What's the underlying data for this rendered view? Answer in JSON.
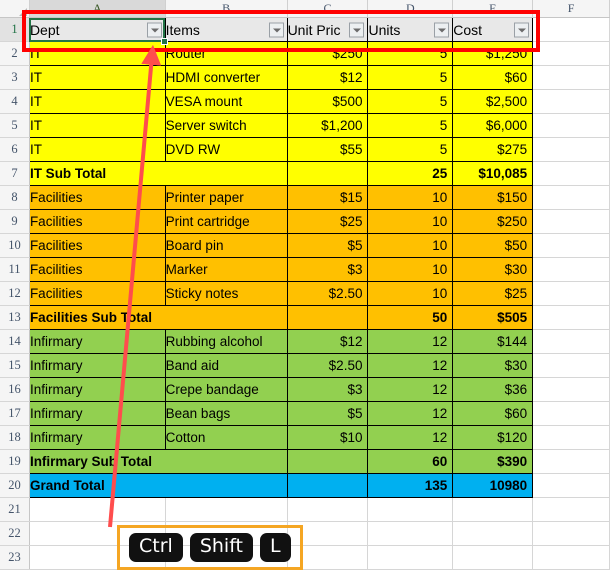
{
  "app": {
    "type": "spreadsheet",
    "column_letters": [
      "A",
      "B",
      "C",
      "D",
      "E",
      "F"
    ],
    "active_cell": "A1",
    "active_column": "A",
    "active_row": "1"
  },
  "colors": {
    "it_fill": "#FFFF00",
    "facilities_fill": "#FFC000",
    "infirmary_fill": "#92D050",
    "grand_total_fill": "#00B0F0",
    "header_fill": "#E8E8E8",
    "callout_red": "#FF0000",
    "callout_orange": "#F5A623",
    "selection_green": "#217346"
  },
  "table": {
    "headers": [
      "Dept",
      "Items",
      "Unit Pric",
      "Units",
      "Cost"
    ],
    "header_full": [
      "Dept",
      "Items",
      "Unit Price",
      "Units",
      "Cost"
    ],
    "rows": [
      {
        "num": "2",
        "section": "it",
        "cells": [
          "IT",
          "Router",
          "$250",
          "5",
          "$1,250"
        ],
        "bold": false
      },
      {
        "num": "3",
        "section": "it",
        "cells": [
          "IT",
          "HDMI converter",
          "$12",
          "5",
          "$60"
        ],
        "bold": false
      },
      {
        "num": "4",
        "section": "it",
        "cells": [
          "IT",
          "VESA mount",
          "$500",
          "5",
          "$2,500"
        ],
        "bold": false
      },
      {
        "num": "5",
        "section": "it",
        "cells": [
          "IT",
          "Server switch",
          "$1,200",
          "5",
          "$6,000"
        ],
        "bold": false
      },
      {
        "num": "6",
        "section": "it",
        "cells": [
          "IT",
          "DVD RW",
          "$55",
          "5",
          "$275"
        ],
        "bold": false
      },
      {
        "num": "7",
        "section": "it",
        "cells": [
          "IT Sub Total",
          "",
          "",
          "25",
          "$10,085"
        ],
        "bold": true,
        "span_ab": true
      },
      {
        "num": "8",
        "section": "facilities",
        "cells": [
          "Facilities",
          "Printer paper",
          "$15",
          "10",
          "$150"
        ],
        "bold": false
      },
      {
        "num": "9",
        "section": "facilities",
        "cells": [
          "Facilities",
          "Print cartridge",
          "$25",
          "10",
          "$250"
        ],
        "bold": false
      },
      {
        "num": "10",
        "section": "facilities",
        "cells": [
          "Facilities",
          "Board pin",
          "$5",
          "10",
          "$50"
        ],
        "bold": false
      },
      {
        "num": "11",
        "section": "facilities",
        "cells": [
          "Facilities",
          "Marker",
          "$3",
          "10",
          "$30"
        ],
        "bold": false
      },
      {
        "num": "12",
        "section": "facilities",
        "cells": [
          "Facilities",
          "Sticky notes",
          "$2.50",
          "10",
          "$25"
        ],
        "bold": false
      },
      {
        "num": "13",
        "section": "facilities",
        "cells": [
          "Facilities Sub Total",
          "",
          "",
          "50",
          "$505"
        ],
        "bold": true,
        "span_ab": true
      },
      {
        "num": "14",
        "section": "infirmary",
        "cells": [
          "Infirmary",
          "Rubbing alcohol",
          "$12",
          "12",
          "$144"
        ],
        "bold": false
      },
      {
        "num": "15",
        "section": "infirmary",
        "cells": [
          "Infirmary",
          "Band aid",
          "$2.50",
          "12",
          "$30"
        ],
        "bold": false
      },
      {
        "num": "16",
        "section": "infirmary",
        "cells": [
          "Infirmary",
          "Crepe bandage",
          "$3",
          "12",
          "$36"
        ],
        "bold": false
      },
      {
        "num": "17",
        "section": "infirmary",
        "cells": [
          "Infirmary",
          "Bean bags",
          "$5",
          "12",
          "$60"
        ],
        "bold": false
      },
      {
        "num": "18",
        "section": "infirmary",
        "cells": [
          "Infirmary",
          "Cotton",
          "$10",
          "12",
          "$120"
        ],
        "bold": false
      },
      {
        "num": "19",
        "section": "infirmary",
        "cells": [
          "Infirmary Sub Total",
          "",
          "",
          "60",
          "$390"
        ],
        "bold": true,
        "span_ab": true
      },
      {
        "num": "20",
        "section": "grand",
        "cells": [
          "Grand Total",
          "",
          "",
          "135",
          "10980"
        ],
        "bold": true,
        "span_ab": true
      },
      {
        "num": "21",
        "section": "empty",
        "cells": [
          "",
          "",
          "",
          "",
          ""
        ],
        "bold": false
      },
      {
        "num": "22",
        "section": "empty",
        "cells": [
          "",
          "",
          "",
          "",
          ""
        ],
        "bold": false
      },
      {
        "num": "23",
        "section": "empty",
        "cells": [
          "",
          "",
          "",
          "",
          ""
        ],
        "bold": false
      }
    ]
  },
  "annotation": {
    "keys": [
      "Ctrl",
      "Shift",
      "L"
    ]
  }
}
